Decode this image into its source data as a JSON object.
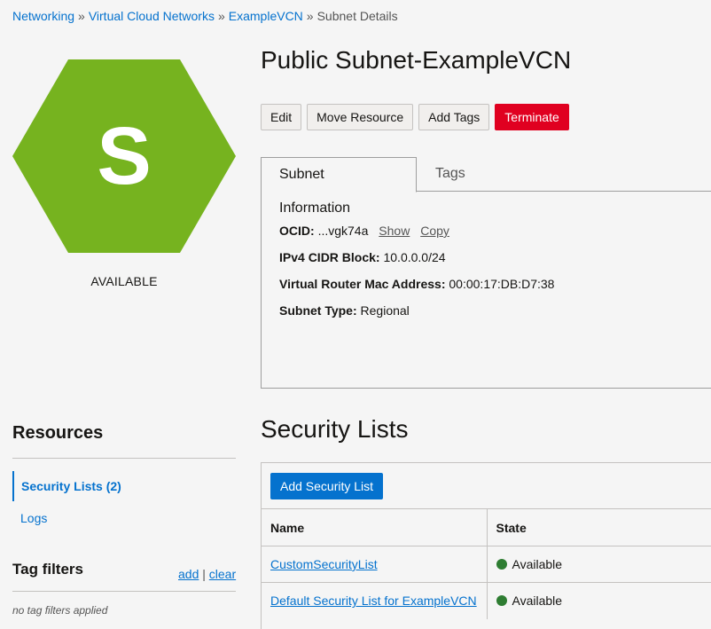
{
  "breadcrumb": {
    "items": [
      "Networking",
      "Virtual Cloud Networks",
      "ExampleVCN"
    ],
    "separator": "»",
    "current": "Subnet Details"
  },
  "resource_icon": {
    "letter": "S",
    "color": "#76b31f",
    "status": "AVAILABLE"
  },
  "page": {
    "title": "Public Subnet-ExampleVCN"
  },
  "actions": {
    "edit": "Edit",
    "move": "Move Resource",
    "add_tags": "Add Tags",
    "terminate": "Terminate"
  },
  "tabs": {
    "info": "Subnet Information",
    "tags": "Tags"
  },
  "details": {
    "ocid_label": "OCID:",
    "ocid_value": "...vgk74a",
    "show": "Show",
    "copy": "Copy",
    "cidr_label": "IPv4 CIDR Block:",
    "cidr_value": "10.0.0.0/24",
    "mac_label": "Virtual Router Mac Address:",
    "mac_value": "00:00:17:DB:D7:38",
    "type_label": "Subnet Type:",
    "type_value": "Regional"
  },
  "resources": {
    "title": "Resources",
    "items": [
      "Security Lists (2)",
      "Logs"
    ]
  },
  "tag_filters": {
    "title": "Tag filters",
    "add": "add",
    "divider": "|",
    "clear": "clear",
    "empty": "no tag filters applied"
  },
  "security_lists": {
    "title": "Security Lists",
    "add_button": "Add Security List",
    "columns": [
      "Name",
      "State"
    ],
    "rows": [
      {
        "name": "CustomSecurityList",
        "state": "Available"
      },
      {
        "name": "Default Security List for ExampleVCN",
        "state": "Available"
      }
    ]
  },
  "colors": {
    "link": "#0572ce",
    "danger": "#e00020",
    "available": "#2e7d32"
  }
}
